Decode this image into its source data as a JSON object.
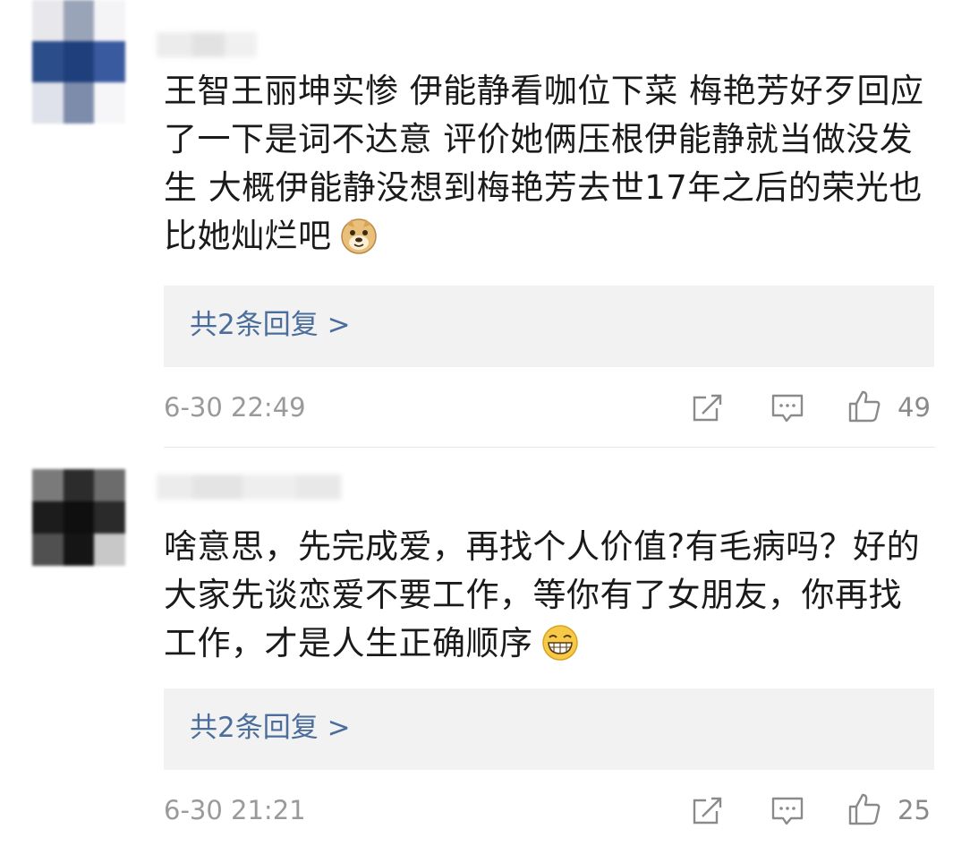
{
  "comments": [
    {
      "text": "王智王丽坤实惨 伊能静看咖位下菜 梅艳芳好歹回应了一下是词不达意 评价她俩压根伊能静就当做没发生 大概伊能静没想到梅艳芳去世17年之后的荣光也比她灿烂吧",
      "emoji_icon": "doge-emoji-icon",
      "replies_label": "共2条回复 >",
      "timestamp": "6-30 22:49",
      "likes": "49"
    },
    {
      "text": "啥意思，先完成爱，再找个人价值?有毛病吗？好的大家先谈恋爱不要工作，等你有了女朋友，你再找工作，才是人生正确顺序",
      "emoji_icon": "grin-emoji-icon",
      "replies_label": "共2条回复 >",
      "timestamp": "6-30 21:21",
      "likes": "25"
    }
  ],
  "icons": {
    "share": "share-icon",
    "comment": "comment-icon",
    "like": "thumbs-up-icon"
  },
  "colors": {
    "link": "#4a6d9c",
    "meta": "#9a9a9a",
    "reply_bg": "#f2f2f2"
  }
}
